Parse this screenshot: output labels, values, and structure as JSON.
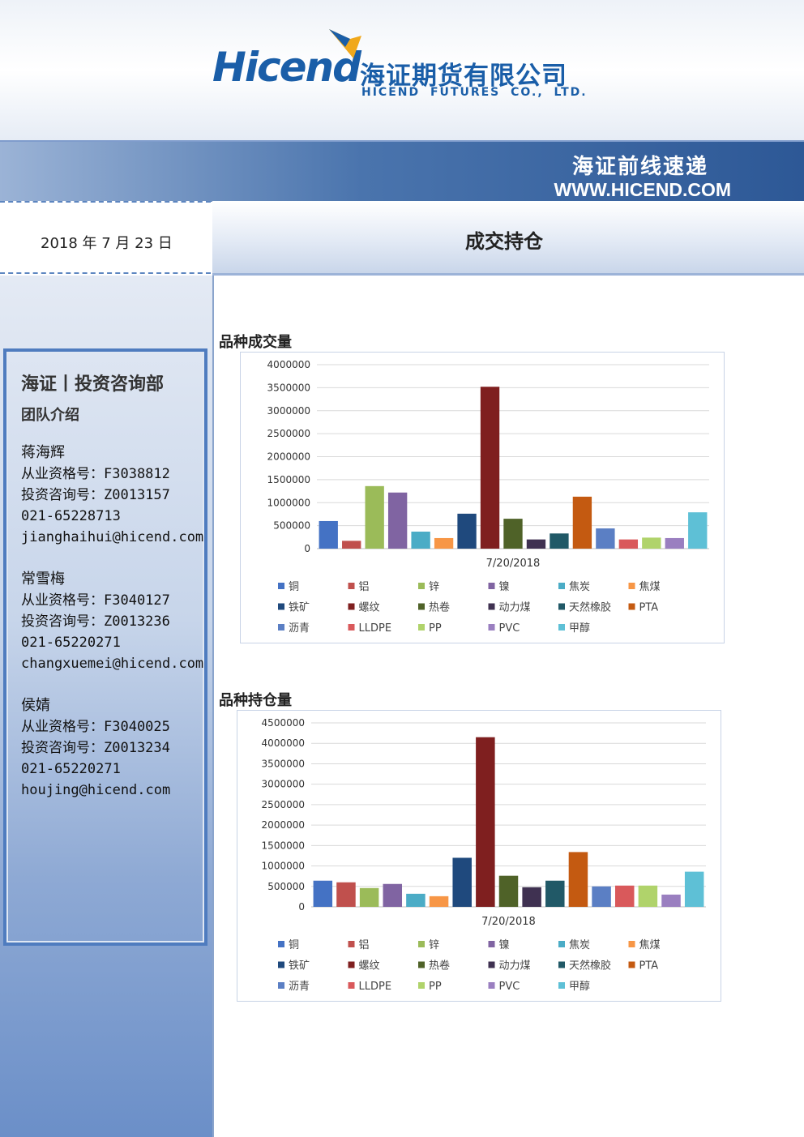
{
  "header": {
    "logo_en": "Hicend",
    "logo_cn": "海证期货有限公司",
    "logo_sub": "HICEND FUTURES CO., LTD.",
    "band_title": "海证前线速递",
    "url": "WWW.HICEND.COM",
    "brand_color": "#1a5ea8"
  },
  "date": "2018 年 7 月 23 日",
  "page_title": "成交持仓",
  "team": {
    "title": "海证丨投资咨询部",
    "subtitle": "团队介绍",
    "members": [
      {
        "name": "蒋海辉",
        "qual": "从业资格号：F3038812",
        "consult": "投资咨询号：Z0013157",
        "phone": "021-65228713",
        "email": "jianghaihui@hicend.com"
      },
      {
        "name": "常雪梅",
        "qual": "从业资格号：F3040127",
        "consult": "投资咨询号：Z0013236",
        "phone": "021-65220271",
        "email": "changxuemei@hicend.com"
      },
      {
        "name": "侯婧",
        "qual": "从业资格号：F3040025",
        "consult": "投资咨询号：Z0013234",
        "phone": "021-65220271",
        "email": "houjing@hicend.com"
      }
    ]
  },
  "chart_data": [
    {
      "type": "bar",
      "title": "品种成交量",
      "categories": [
        "7/20/2018"
      ],
      "ylim": [
        0,
        4000000
      ],
      "yticks": [
        0,
        500000,
        1000000,
        1500000,
        2000000,
        2500000,
        3000000,
        3500000,
        4000000
      ],
      "grid": true,
      "legend_position": "bottom",
      "series": [
        {
          "name": "铜",
          "color": "#4472c4",
          "values": [
            600000
          ]
        },
        {
          "name": "铝",
          "color": "#c0504d",
          "values": [
            170000
          ]
        },
        {
          "name": "锌",
          "color": "#9bbb59",
          "values": [
            1360000
          ]
        },
        {
          "name": "镍",
          "color": "#8064a2",
          "values": [
            1220000
          ]
        },
        {
          "name": "焦炭",
          "color": "#4bacc6",
          "values": [
            370000
          ]
        },
        {
          "name": "焦煤",
          "color": "#f79646",
          "values": [
            230000
          ]
        },
        {
          "name": "铁矿",
          "color": "#1f497d",
          "values": [
            760000
          ]
        },
        {
          "name": "螺纹",
          "color": "#7f1f1f",
          "values": [
            3520000
          ]
        },
        {
          "name": "热卷",
          "color": "#4f6228",
          "values": [
            650000
          ]
        },
        {
          "name": "动力煤",
          "color": "#3f3151",
          "values": [
            200000
          ]
        },
        {
          "name": "天然橡胶",
          "color": "#215967",
          "values": [
            330000
          ]
        },
        {
          "name": "PTA",
          "color": "#c45a11",
          "values": [
            1130000
          ]
        },
        {
          "name": "沥青",
          "color": "#5b7fc4",
          "values": [
            440000
          ]
        },
        {
          "name": "LLDPE",
          "color": "#d9595b",
          "values": [
            200000
          ]
        },
        {
          "name": "PP",
          "color": "#b0d36b",
          "values": [
            240000
          ]
        },
        {
          "name": "PVC",
          "color": "#9a7fc0",
          "values": [
            230000
          ]
        },
        {
          "name": "甲醇",
          "color": "#5ec0d6",
          "values": [
            790000
          ]
        }
      ]
    },
    {
      "type": "bar",
      "title": "品种持仓量",
      "categories": [
        "7/20/2018"
      ],
      "ylim": [
        0,
        4500000
      ],
      "yticks": [
        0,
        500000,
        1000000,
        1500000,
        2000000,
        2500000,
        3000000,
        3500000,
        4000000,
        4500000
      ],
      "grid": true,
      "legend_position": "bottom",
      "series": [
        {
          "name": "铜",
          "color": "#4472c4",
          "values": [
            640000
          ]
        },
        {
          "name": "铝",
          "color": "#c0504d",
          "values": [
            600000
          ]
        },
        {
          "name": "锌",
          "color": "#9bbb59",
          "values": [
            460000
          ]
        },
        {
          "name": "镍",
          "color": "#8064a2",
          "values": [
            560000
          ]
        },
        {
          "name": "焦炭",
          "color": "#4bacc6",
          "values": [
            320000
          ]
        },
        {
          "name": "焦煤",
          "color": "#f79646",
          "values": [
            260000
          ]
        },
        {
          "name": "铁矿",
          "color": "#1f497d",
          "values": [
            1200000
          ]
        },
        {
          "name": "螺纹",
          "color": "#7f1f1f",
          "values": [
            4150000
          ]
        },
        {
          "name": "热卷",
          "color": "#4f6228",
          "values": [
            760000
          ]
        },
        {
          "name": "动力煤",
          "color": "#3f3151",
          "values": [
            480000
          ]
        },
        {
          "name": "天然橡胶",
          "color": "#215967",
          "values": [
            640000
          ]
        },
        {
          "name": "PTA",
          "color": "#c45a11",
          "values": [
            1340000
          ]
        },
        {
          "name": "沥青",
          "color": "#5b7fc4",
          "values": [
            500000
          ]
        },
        {
          "name": "LLDPE",
          "color": "#d9595b",
          "values": [
            520000
          ]
        },
        {
          "name": "PP",
          "color": "#b0d36b",
          "values": [
            520000
          ]
        },
        {
          "name": "PVC",
          "color": "#9a7fc0",
          "values": [
            300000
          ]
        },
        {
          "name": "甲醇",
          "color": "#5ec0d6",
          "values": [
            860000
          ]
        }
      ]
    }
  ]
}
